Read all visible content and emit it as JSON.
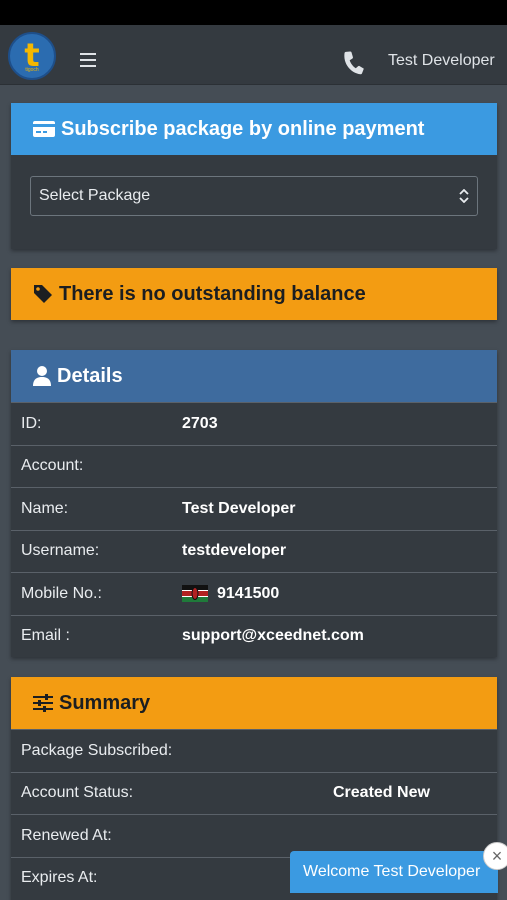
{
  "header": {
    "logo_letter": "t",
    "logo_sub": "tigoch",
    "menu_icon": "hamburger-icon",
    "phone_icon": "phone-icon",
    "user_name": "Test Developer"
  },
  "subscribe": {
    "title": "Subscribe package by online payment",
    "icon": "credit-card-icon",
    "color": "#3b9ae1",
    "select_value": "Select Package"
  },
  "balance": {
    "title": "There is no outstanding balance",
    "icon": "tag-icon",
    "color": "#f39c12"
  },
  "details": {
    "title": "Details",
    "icon": "user-icon",
    "color": "#3e6b9e",
    "rows": [
      {
        "label": "ID:",
        "value": "2703"
      },
      {
        "label": "Account:",
        "value": ""
      },
      {
        "label": "Name:",
        "value": "Test Developer"
      },
      {
        "label": "Username:",
        "value": "testdeveloper"
      },
      {
        "label": "Mobile No.:",
        "value": "9141500"
      },
      {
        "label": "Email :",
        "value": "support@xceednet.com"
      }
    ]
  },
  "summary": {
    "title": "Summary",
    "icon": "sliders-icon",
    "color": "#f39c12",
    "rows": [
      {
        "label": "Package Subscribed:",
        "value": ""
      },
      {
        "label": "Account Status:",
        "value": "Created New"
      },
      {
        "label": "Renewed At:",
        "value": ""
      },
      {
        "label": "Expires At:",
        "value": ""
      }
    ]
  },
  "toast": {
    "message": "Welcome Test Developer",
    "close": "×"
  }
}
